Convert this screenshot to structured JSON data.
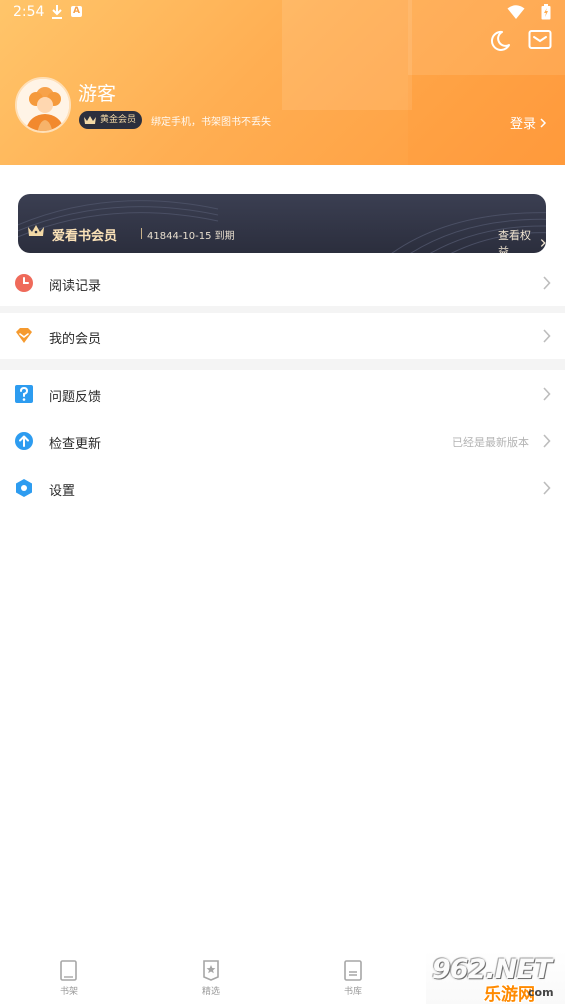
{
  "status_bar": {
    "time": "2:54",
    "a_badge": "A"
  },
  "header": {
    "username": "游客",
    "vip_badge": "黄金会员",
    "bind_tip": "绑定手机，书架图书不丢失",
    "login": "登录",
    "icons": [
      "moon-icon",
      "mail-icon"
    ],
    "accent_color": "#ffae52"
  },
  "vip_card": {
    "title": "爱看书会员",
    "expiry": "41844-10-15 到期",
    "benefit": "查看权益"
  },
  "menu": {
    "reading_history": {
      "label": "阅读记录",
      "icon": "clock-icon",
      "color": "#ef6a5a"
    },
    "my_membership": {
      "label": "我的会员",
      "icon": "diamond-icon",
      "color": "#f59a2f"
    },
    "feedback": {
      "label": "问题反馈",
      "icon": "question-icon",
      "color": "#2d9cf0"
    },
    "check_update": {
      "label": "检查更新",
      "icon": "upload-icon",
      "color": "#2d9cf0",
      "status": "已经是最新版本"
    },
    "settings": {
      "label": "设置",
      "icon": "hexagon-settings-icon",
      "color": "#2d9cf0"
    }
  },
  "bottom_nav": {
    "items": [
      {
        "label": "书架",
        "icon": "bookshelf-icon"
      },
      {
        "label": "精选",
        "icon": "featured-icon"
      },
      {
        "label": "书库",
        "icon": "library-icon"
      }
    ]
  },
  "watermark": {
    "brand": "962.NET",
    "sub": "乐游网",
    "com": "com"
  }
}
